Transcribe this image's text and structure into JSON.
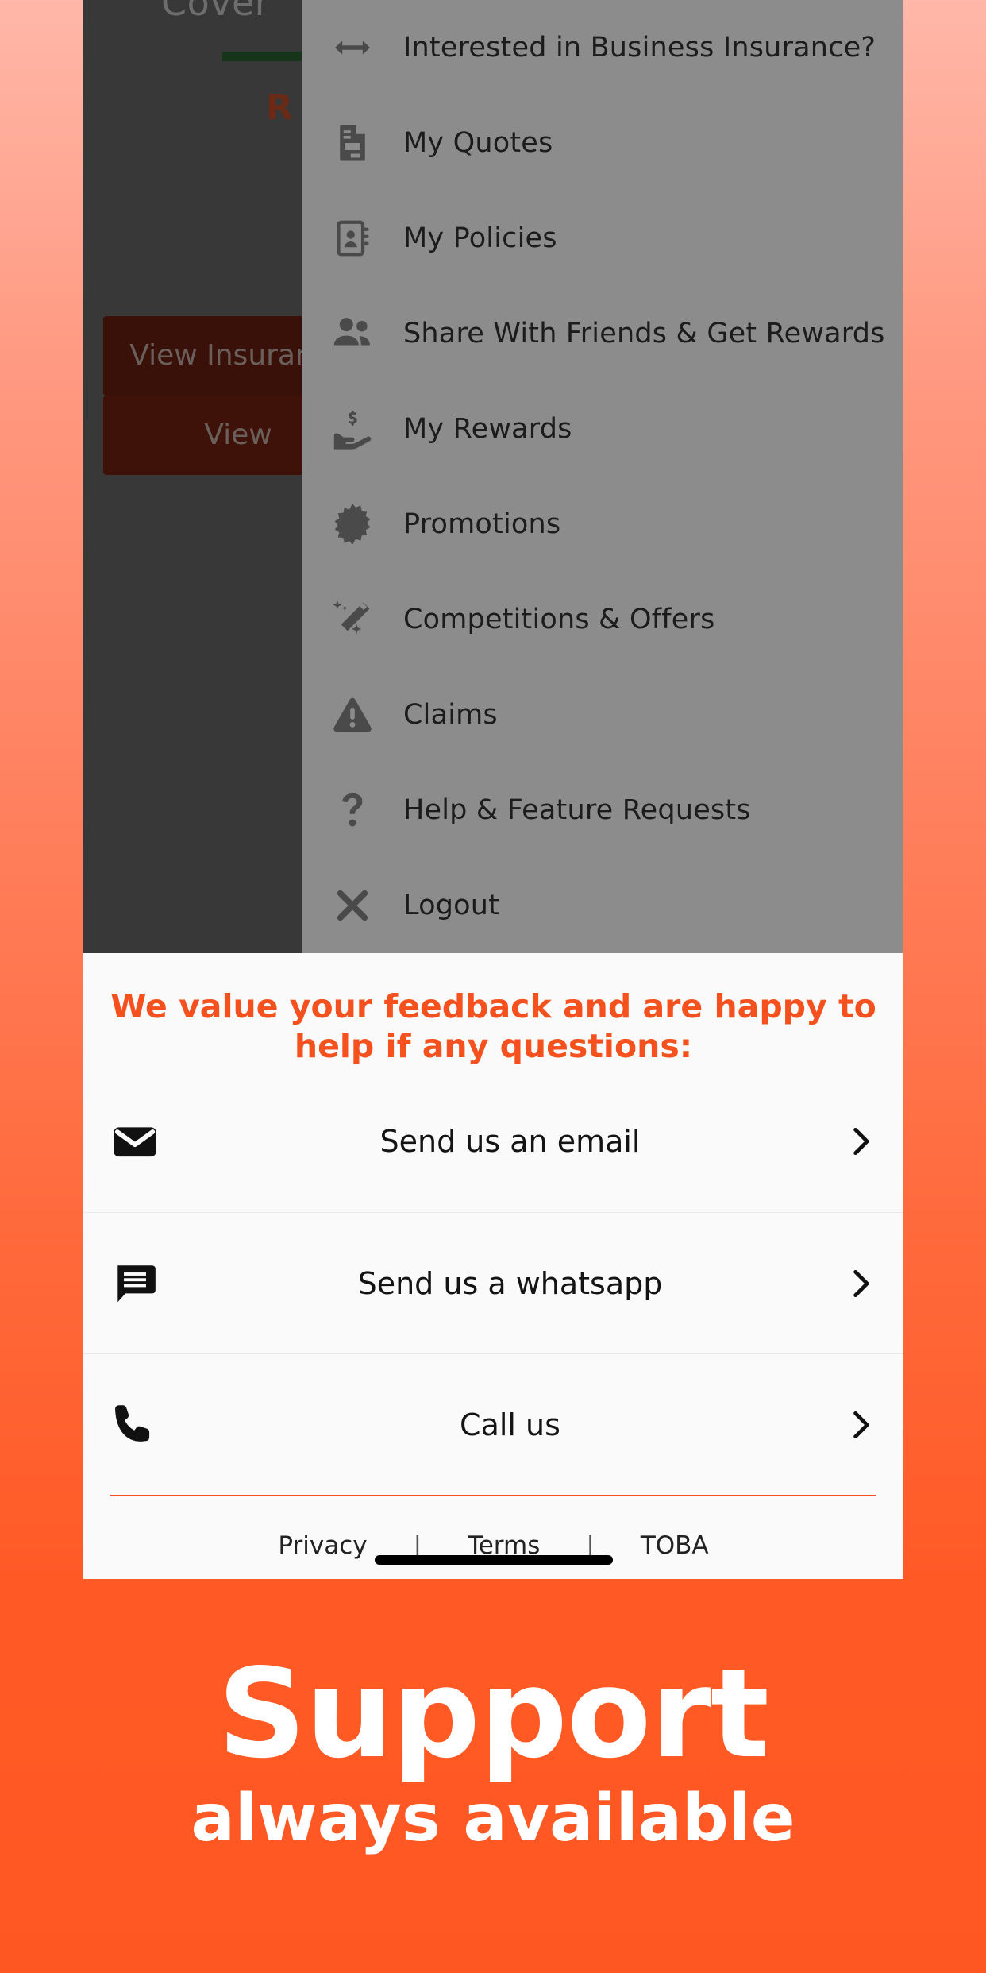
{
  "background": {
    "gradient_top": "#ffb7a8",
    "gradient_bottom": "#ff5722",
    "accent": "#f4511e"
  },
  "app_behind": {
    "title": "Cover",
    "amount": "R",
    "button_1_label": "View Insurance",
    "button_2_label": "View"
  },
  "drawer": {
    "background": "#8c8c8c",
    "items": [
      {
        "icon": "arrows-horizontal-icon",
        "label": "Interested in Business Insurance?"
      },
      {
        "icon": "document-quote-icon",
        "label": "My Quotes"
      },
      {
        "icon": "contact-book-icon",
        "label": "My Policies"
      },
      {
        "icon": "people-group-icon",
        "label": "Share With Friends & Get Rewards"
      },
      {
        "icon": "hand-money-icon",
        "label": "My Rewards"
      },
      {
        "icon": "starburst-icon",
        "label": "Promotions"
      },
      {
        "icon": "magic-wand-icon",
        "label": "Competitions & Offers"
      },
      {
        "icon": "warning-triangle-icon",
        "label": "Claims"
      },
      {
        "icon": "question-mark-icon",
        "label": "Help & Feature Requests"
      },
      {
        "icon": "close-x-icon",
        "label": "Logout"
      }
    ]
  },
  "feedback": {
    "title": "We value your feedback and are happy to help if any questions:",
    "title_color": "#f4511e",
    "contacts": [
      {
        "icon": "envelope-icon",
        "label": "Send us an email",
        "chevron": "chevron-right-icon"
      },
      {
        "icon": "chat-bubble-icon",
        "label": "Send us a whatsapp",
        "chevron": "chevron-right-icon"
      },
      {
        "icon": "phone-icon",
        "label": "Call us",
        "chevron": "chevron-right-icon"
      }
    ],
    "footer_links": [
      {
        "label": "Privacy"
      },
      {
        "label": "Terms"
      },
      {
        "label": "TOBA"
      }
    ],
    "footer_separator": "|"
  },
  "caption": {
    "main": "Support",
    "sub": "always available"
  }
}
